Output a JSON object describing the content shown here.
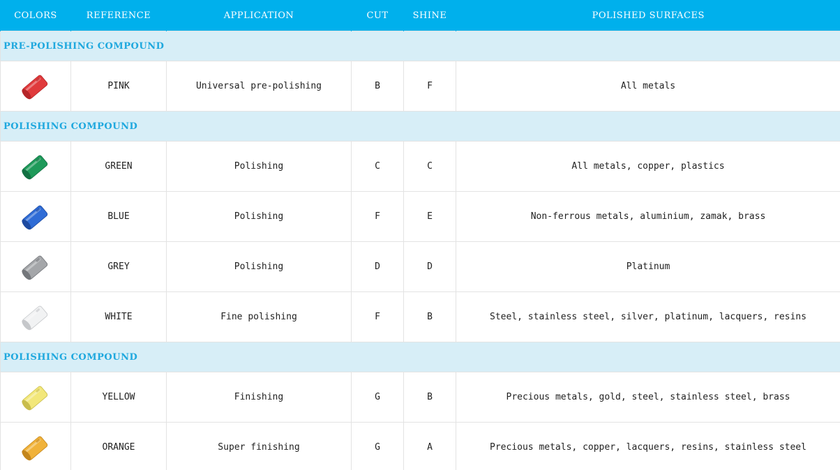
{
  "header": {
    "colors": "COLORS",
    "reference": "REFERENCE",
    "application": "APPLICATION",
    "cut": "CUT",
    "shine": "SHINE",
    "surfaces": "POLISHED SURFACES"
  },
  "sections": [
    {
      "title": "PRE-POLISHING COMPOUND",
      "rows": [
        {
          "color": "#e03a3c",
          "dark": "#b52528",
          "reference": "PINK",
          "application": "Universal pre-polishing",
          "cut": "B",
          "shine": "F",
          "surfaces": "All metals"
        }
      ]
    },
    {
      "title": "POLISHING COMPOUND",
      "rows": [
        {
          "color": "#1e9a5a",
          "dark": "#127042",
          "reference": "GREEN",
          "application": "Polishing",
          "cut": "C",
          "shine": "C",
          "surfaces": "All metals, copper, plastics"
        },
        {
          "color": "#2f6cd6",
          "dark": "#1d4aa0",
          "reference": "BLUE",
          "application": "Polishing",
          "cut": "F",
          "shine": "E",
          "surfaces": "Non-ferrous metals, aluminium, zamak, brass"
        },
        {
          "color": "#a4a6a9",
          "dark": "#74777b",
          "reference": "GREY",
          "application": "Polishing",
          "cut": "D",
          "shine": "D",
          "surfaces": "Platinum"
        },
        {
          "color": "#f1f2f3",
          "dark": "#c5c7ca",
          "reference": "WHITE",
          "application": "Fine polishing",
          "cut": "F",
          "shine": "B",
          "surfaces": "Steel, stainless steel, silver, platinum, lacquers, resins"
        }
      ]
    },
    {
      "title": "POLISHING COMPOUND",
      "rows": [
        {
          "color": "#f2e77a",
          "dark": "#c9bd4c",
          "reference": "YELLOW",
          "application": "Finishing",
          "cut": "G",
          "shine": "B",
          "surfaces": "Precious metals, gold, steel, stainless steel, brass"
        },
        {
          "color": "#f0b23a",
          "dark": "#c4861c",
          "reference": "ORANGE",
          "application": "Super finishing",
          "cut": "G",
          "shine": "A",
          "surfaces": "Precious metals, copper, lacquers, resins, stainless steel"
        }
      ]
    }
  ]
}
